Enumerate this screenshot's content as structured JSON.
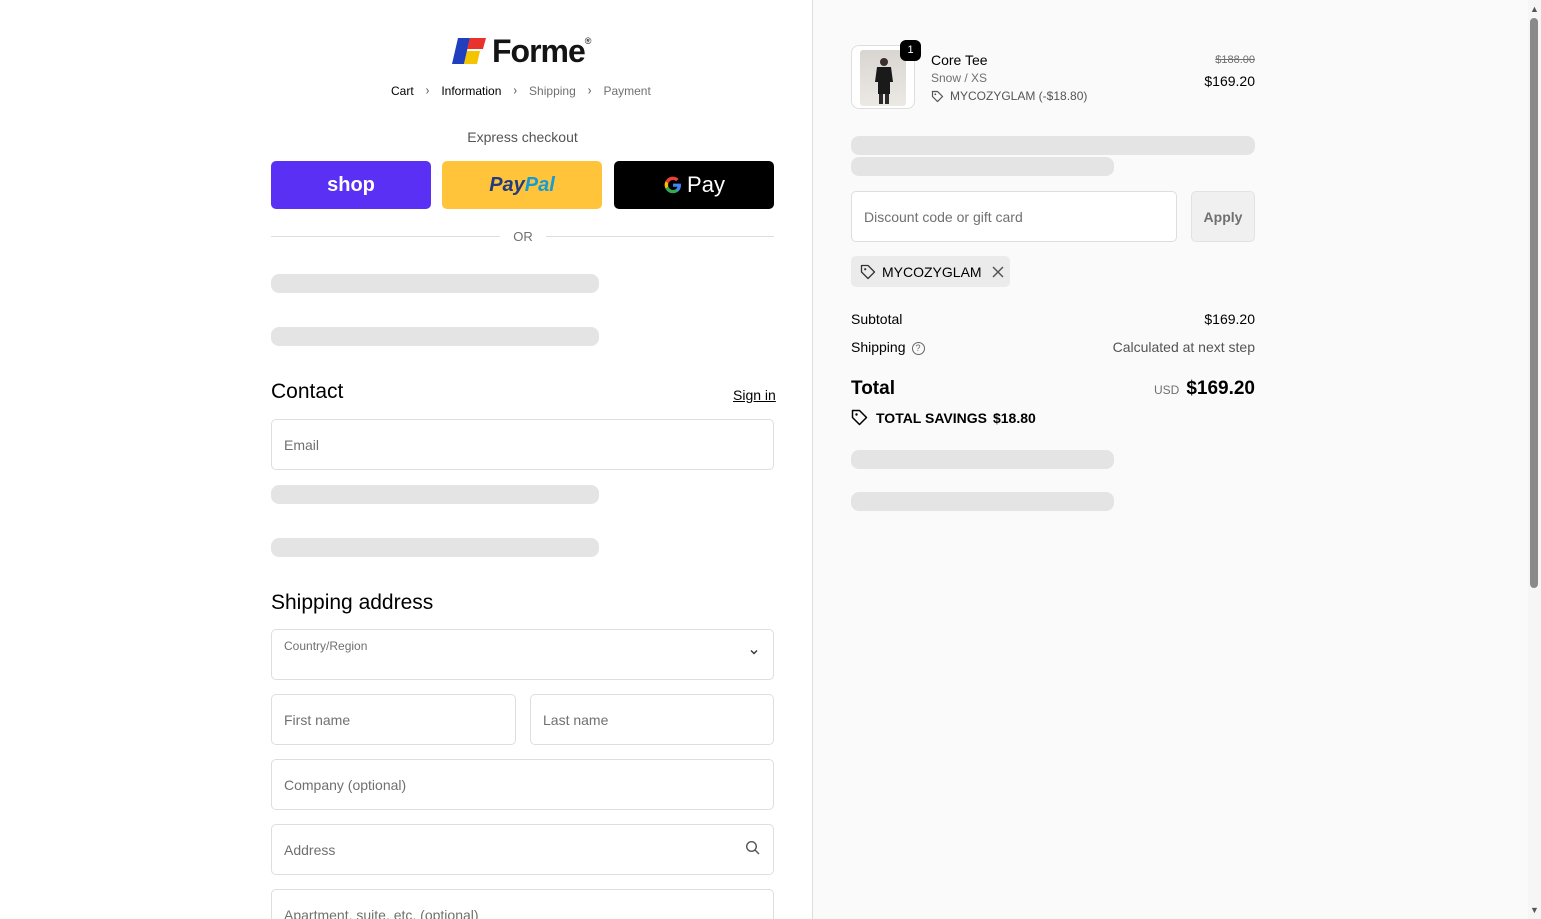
{
  "brand": {
    "name": "Forme",
    "mark": "®"
  },
  "breadcrumb": [
    {
      "label": "Cart",
      "state": "link"
    },
    {
      "label": "Information",
      "state": "active"
    },
    {
      "label": "Shipping",
      "state": "inactive"
    },
    {
      "label": "Payment",
      "state": "inactive"
    }
  ],
  "express": {
    "title": "Express checkout",
    "shop_label": "shop",
    "paypal_label_1": "Pay",
    "paypal_label_2": "Pal",
    "gpay_label": "Pay",
    "gpay_g": "G",
    "or_label": "OR"
  },
  "contact": {
    "heading": "Contact",
    "sign_in": "Sign in",
    "email_placeholder": "Email"
  },
  "shipping": {
    "heading": "Shipping address",
    "country_label": "Country/Region",
    "first_name_placeholder": "First name",
    "last_name_placeholder": "Last name",
    "company_placeholder": "Company (optional)",
    "address_placeholder": "Address",
    "apartment_placeholder": "Apartment, suite, etc. (optional)"
  },
  "summary": {
    "item": {
      "quantity": "1",
      "name": "Core Tee",
      "variant": "Snow / XS",
      "discount": "MYCOZYGLAM (-$18.80)",
      "original_price": "$188.00",
      "price": "$169.20"
    },
    "discount_placeholder": "Discount code or gift card",
    "apply_label": "Apply",
    "applied_code": "MYCOZYGLAM",
    "subtotal_label": "Subtotal",
    "subtotal_value": "$169.20",
    "shipping_label": "Shipping",
    "shipping_value": "Calculated at next step",
    "total_label": "Total",
    "currency": "USD",
    "total_value": "$169.20",
    "savings_label": "TOTAL SAVINGS",
    "savings_value": "$18.80"
  },
  "colors": {
    "shop": "#5a31f4",
    "paypal": "#ffc439",
    "gpay": "#000000",
    "skeleton": "#e4e4e4"
  }
}
